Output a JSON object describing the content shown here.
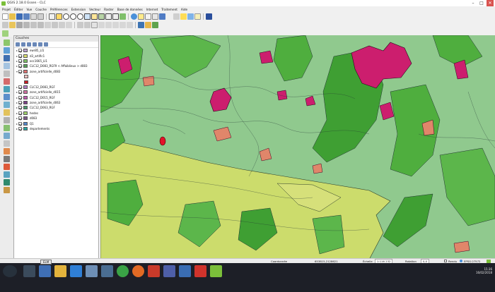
{
  "window": {
    "title": "QGIS 2.18.0 Essen - CLC",
    "controls": [
      "–",
      "□",
      "✕"
    ]
  },
  "menu": {
    "items": [
      "Projet",
      "Éditer",
      "Vue",
      "Couche",
      "Préférences",
      "Extension",
      "Vecteur",
      "Raster",
      "Base de données",
      "Internet",
      "Traitement",
      "Aide"
    ]
  },
  "layers_panel": {
    "title": "Couches",
    "layers": [
      {
        "name": "ewr85_LI1",
        "checked": true,
        "expanded": false,
        "color": "#b9a0d0"
      },
      {
        "name": "d3_artific1",
        "checked": true,
        "expanded": false,
        "color": "#dbe06f"
      },
      {
        "name": "occ1665_LI1",
        "checked": true,
        "expanded": false,
        "color": "#7fc066"
      },
      {
        "name": "CLC12_D083_RGF9 < Affaiblieux > d083",
        "checked": true,
        "expanded": false,
        "color": "#5aa35a"
      },
      {
        "name": "zone_artificielle_d083",
        "checked": true,
        "expanded": true,
        "color": "#e07272"
      },
      {
        "name": "",
        "checked": false,
        "expanded": false,
        "color": "#f4c2c2"
      },
      {
        "name": "",
        "checked": false,
        "expanded": false,
        "color": "#c81d25"
      },
      {
        "name": "CLC12_D083_RGF",
        "checked": true,
        "expanded": false,
        "color": "#b07cc6"
      },
      {
        "name": "zone_artificielle_d015",
        "checked": true,
        "expanded": false,
        "color": "#d06ea0"
      },
      {
        "name": "CLC12_D015_RGF",
        "checked": true,
        "expanded": false,
        "color": "#c15ab0"
      },
      {
        "name": "zone_artificielle_d063",
        "checked": true,
        "expanded": false,
        "color": "#7a3f86"
      },
      {
        "name": "CLC12_D063_RGF",
        "checked": true,
        "expanded": false,
        "color": "#4a9a6e"
      },
      {
        "name": "hedes",
        "checked": true,
        "expanded": false,
        "color": "#9fd26a"
      },
      {
        "name": "d083",
        "checked": true,
        "expanded": false,
        "color": "#7d5a8a"
      },
      {
        "name": "Q1",
        "checked": true,
        "expanded": false,
        "color": "#5588cc"
      },
      {
        "name": "departements",
        "checked": true,
        "expanded": false,
        "color": "#2aa5a0"
      }
    ]
  },
  "statusbar": {
    "coord_label": "Coordonnée",
    "coord_value": "653815,2128621",
    "scale_label": "Échelle",
    "scale_value": "1:116 232",
    "rotation_label": "Rotation",
    "rotation_value": "0,0",
    "render_label": "Rendu",
    "crs": "EPSG:27572"
  },
  "taskbar": {
    "tooltip": "ELM",
    "clock_time": "15:36",
    "clock_date": "16/02/2018"
  },
  "colors": {
    "map_bg": "#90c98e",
    "forest": "#4fae3e",
    "agri_yellow": "#ccdc6c",
    "urban": "#cc1e6e",
    "salmon": "#e0866a",
    "taskbar": "#1d1f27"
  }
}
